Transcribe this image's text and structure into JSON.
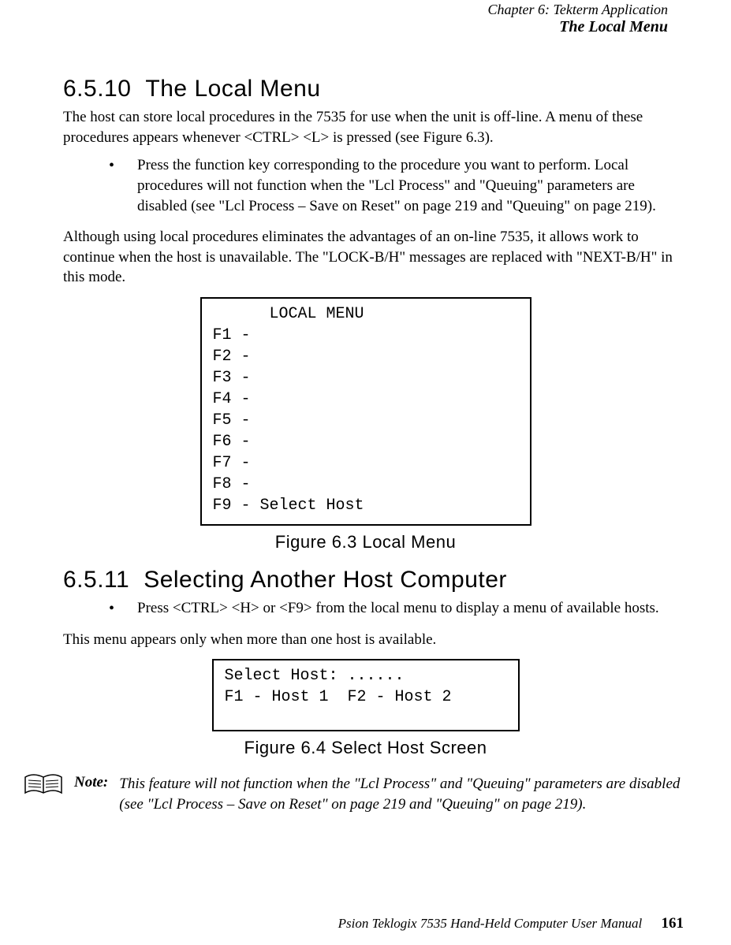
{
  "header": {
    "chapter_line": "Chapter 6: Tekterm Application",
    "section_line": "The Local Menu"
  },
  "sec_6_5_10": {
    "number": "6.5.10",
    "title": "The Local Menu",
    "para1": "The host can store local procedures in the 7535 for use when the unit is off-line. A menu of these procedures appears whenever <CTRL> <L> is pressed (see Figure 6.3).",
    "bullet1": "Press the function key corresponding to the procedure you want to perform. Local procedures will not function when the \"Lcl Process\" and \"Queuing\" parameters are disabled (see \"Lcl Process – Save on Reset\" on page 219 and \"Queuing\" on page 219).",
    "para2": "Although using local procedures eliminates the advantages of an on-line 7535, it allows work to continue when the host is unavailable. The \"LOCK-B/H\" messages are replaced with \"NEXT-B/H\" in this mode.",
    "screen": "      LOCAL MENU\nF1 -\nF2 -\nF3 -\nF4 -\nF5 -\nF6 -\nF7 -\nF8 -\nF9 - Select Host",
    "figure_caption": "Figure 6.3 Local Menu"
  },
  "sec_6_5_11": {
    "number": "6.5.11",
    "title": "Selecting Another Host Computer",
    "bullet1": "Press <CTRL> <H> or <F9> from the local menu to display a menu of available hosts.",
    "para1": "This menu appears only when more than one host is available.",
    "screen": "Select Host: ......\nF1 - Host 1  F2 - Host 2",
    "figure_caption": "Figure 6.4 Select Host Screen"
  },
  "note": {
    "label": "Note:",
    "text": "This feature will not function when the \"Lcl Process\" and \"Queuing\" parameters are disabled (see \"Lcl Process – Save on Reset\" on page 219 and \"Queuing\" on page 219)."
  },
  "footer": {
    "text": "Psion Teklogix 7535 Hand-Held Computer User Manual",
    "page": "161"
  }
}
